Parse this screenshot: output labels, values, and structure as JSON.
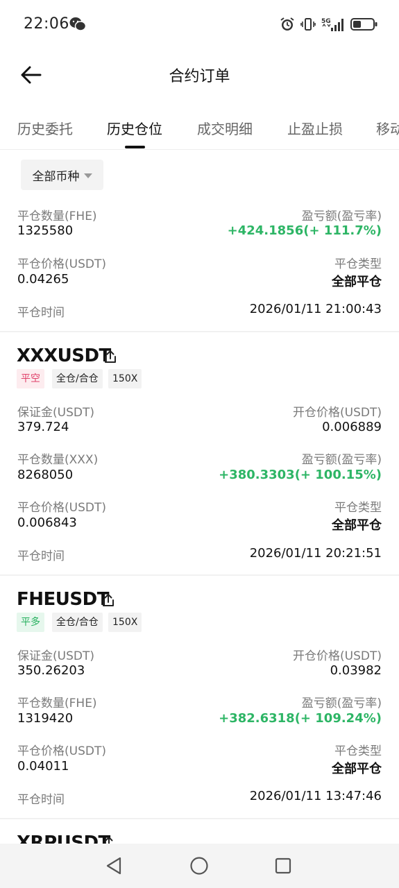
{
  "status": {
    "time": "22:06",
    "network": "5G"
  },
  "header": {
    "title": "合约订单"
  },
  "tabs": [
    {
      "label": "历史委托"
    },
    {
      "label": "历史仓位"
    },
    {
      "label": "成交明细"
    },
    {
      "label": "止盈止损"
    },
    {
      "label": "移动"
    }
  ],
  "filter": {
    "label": "全部币种"
  },
  "record0": {
    "qty_label": "平仓数量(FHE)",
    "qty": "1325580",
    "pnl_label": "盈亏额(盈亏率)",
    "pnl": "+424.1856(+ 111.7%)",
    "close_price_label": "平仓价格(USDT)",
    "close_price": "0.04265",
    "close_type_label": "平仓类型",
    "close_type": "全部平仓",
    "close_time_label": "平仓时间",
    "close_time": "2026/01/11 21:00:43"
  },
  "records": [
    {
      "symbol": "XXXUSDT",
      "side": "平空",
      "mode": "全仓/合仓",
      "leverage": "150X",
      "margin_label": "保证金(USDT)",
      "margin": "379.724",
      "open_price_label": "开仓价格(USDT)",
      "open_price": "0.006889",
      "qty_label": "平仓数量(XXX)",
      "qty": "8268050",
      "pnl_label": "盈亏额(盈亏率)",
      "pnl": "+380.3303(+ 100.15%)",
      "close_price_label": "平仓价格(USDT)",
      "close_price": "0.006843",
      "close_type_label": "平仓类型",
      "close_type": "全部平仓",
      "close_time_label": "平仓时间",
      "close_time": "2026/01/11 20:21:51"
    },
    {
      "symbol": "FHEUSDT",
      "side": "平多",
      "mode": "全仓/合仓",
      "leverage": "150X",
      "margin_label": "保证金(USDT)",
      "margin": "350.26203",
      "open_price_label": "开仓价格(USDT)",
      "open_price": "0.03982",
      "qty_label": "平仓数量(FHE)",
      "qty": "1319420",
      "pnl_label": "盈亏额(盈亏率)",
      "pnl": "+382.6318(+ 109.24%)",
      "close_price_label": "平仓价格(USDT)",
      "close_price": "0.04011",
      "close_type_label": "平仓类型",
      "close_type": "全部平仓",
      "close_time_label": "平仓时间",
      "close_time": "2026/01/11 13:47:46"
    },
    {
      "symbol": "XRPUSDT"
    }
  ],
  "icons": {
    "back": "arrow-left-icon",
    "share": "share-icon",
    "filter_caret": "caret-down-icon",
    "nav_back": "triangle-back-icon",
    "nav_home": "circle-home-icon",
    "nav_recent": "square-recent-icon"
  },
  "colors": {
    "profit": "#2db565",
    "short_badge": "#e0416a",
    "long_badge": "#26b05e"
  }
}
